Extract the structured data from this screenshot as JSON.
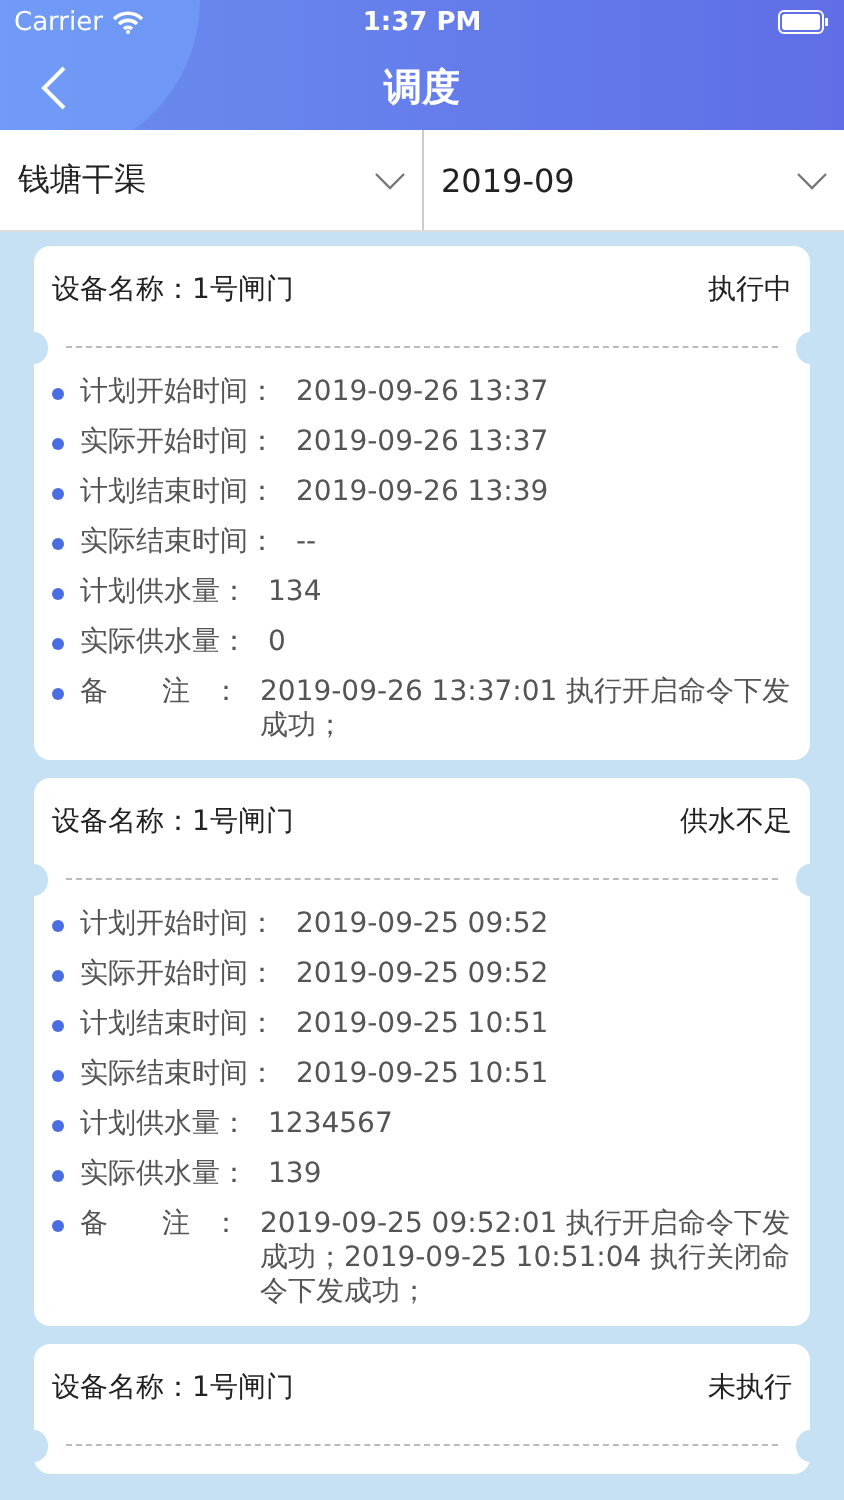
{
  "status_bar": {
    "carrier": "Carrier",
    "time": "1:37 PM"
  },
  "nav": {
    "title": "调度"
  },
  "filters": [
    {
      "value": "钱塘干渠"
    },
    {
      "value": "2019-09"
    }
  ],
  "cards": [
    {
      "device": "设备名称：1号闸门",
      "status": "执行中",
      "fields": [
        {
          "kind": "field",
          "label": "计划开始时间：",
          "value": "2019-09-26 13:37"
        },
        {
          "kind": "field",
          "label": "实际开始时间：",
          "value": "2019-09-26 13:37"
        },
        {
          "kind": "field",
          "label": "计划结束时间：",
          "value": "2019-09-26 13:39"
        },
        {
          "kind": "field",
          "label": "实际结束时间：",
          "value": "--"
        },
        {
          "kind": "field",
          "label": "计划供水量：",
          "value": "134"
        },
        {
          "kind": "field",
          "label": "实际供水量：",
          "value": "0"
        },
        {
          "kind": "note",
          "label": "备 注：",
          "value": "2019-09-26 13:37:01  执行开启命令下发成功；"
        }
      ]
    },
    {
      "device": "设备名称：1号闸门",
      "status": "供水不足",
      "fields": [
        {
          "kind": "field",
          "label": "计划开始时间：",
          "value": "2019-09-25 09:52"
        },
        {
          "kind": "field",
          "label": "实际开始时间：",
          "value": "2019-09-25 09:52"
        },
        {
          "kind": "field",
          "label": "计划结束时间：",
          "value": "2019-09-25 10:51"
        },
        {
          "kind": "field",
          "label": "实际结束时间：",
          "value": "2019-09-25 10:51"
        },
        {
          "kind": "field",
          "label": "计划供水量：",
          "value": "1234567"
        },
        {
          "kind": "field",
          "label": "实际供水量：",
          "value": "139"
        },
        {
          "kind": "note",
          "label": "备 注：",
          "value": "2019-09-25 09:52:01  执行开启命令下发成功；2019-09-25 10:51:04  执行关闭命令下发成功；"
        }
      ]
    },
    {
      "device": "设备名称：1号闸门",
      "status": "未执行"
    }
  ]
}
